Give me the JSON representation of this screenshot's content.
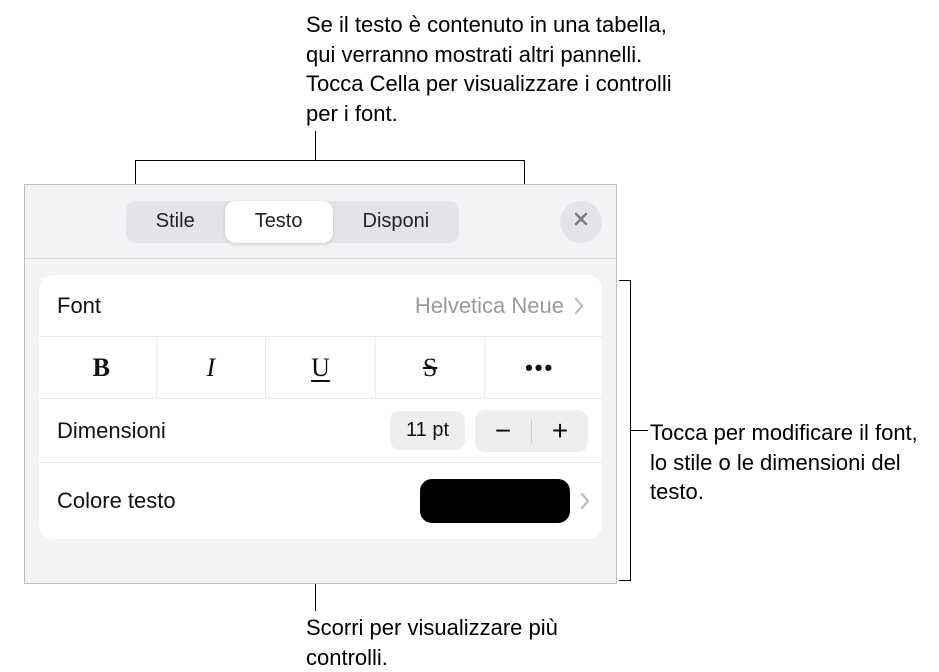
{
  "callouts": {
    "top": "Se il testo è contenuto in una tabella, qui verranno mostrati altri pannelli. Tocca Cella per visualizzare i controlli per i font.",
    "right": "Tocca per modificare il font, lo stile o le dimensioni del testo.",
    "bottom": "Scorri per visualizzare più controlli."
  },
  "tabs": {
    "items": [
      "Stile",
      "Testo",
      "Disponi"
    ],
    "active_index": 1
  },
  "rows": {
    "font": {
      "label": "Font",
      "value": "Helvetica Neue"
    },
    "styles": {
      "bold": "B",
      "italic": "I",
      "underline": "U",
      "strike": "S",
      "more": "•••"
    },
    "size": {
      "label": "Dimensioni",
      "value": "11 pt",
      "minus": "−",
      "plus": "+"
    },
    "text_color": {
      "label": "Colore testo",
      "swatch_hex": "#000000"
    }
  }
}
